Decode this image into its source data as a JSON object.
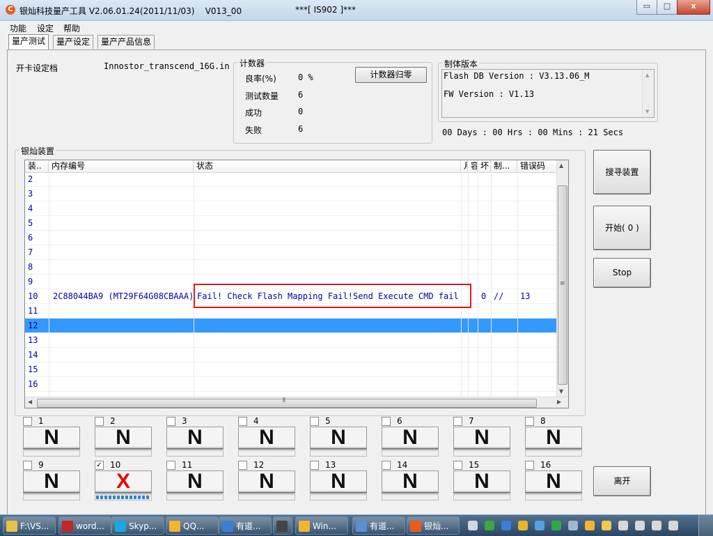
{
  "window": {
    "title_left": "银灿科技量产工具 V2.06.01.24(2011/11/03)    V013_00",
    "title_center": "***[ IS902 ]***",
    "buttons": [
      "▭",
      "□",
      "x"
    ]
  },
  "menu": [
    "功能",
    "设定",
    "帮助"
  ],
  "tabs": [
    "量产测试",
    "量产设定",
    "量产产品信息"
  ],
  "config": {
    "label": "开卡设定档",
    "file": "Innostor_transcend_16G.in"
  },
  "counter": {
    "title": "计数器",
    "rows": [
      {
        "label": "良率(%)",
        "value": "0 %"
      },
      {
        "label": "测试数量",
        "value": "6"
      },
      {
        "label": "成功",
        "value": "0"
      },
      {
        "label": "失败",
        "value": "6"
      }
    ],
    "reset_button": "计数器归零"
  },
  "firmware": {
    "title": "制体版本",
    "line1": "Flash DB Version :  V3.13.06_M",
    "line2": "FW Version :   V1.13"
  },
  "timer": "00 Days : 00 Hrs : 00 Mins : 21 Secs",
  "devices": {
    "title": "银灿装置",
    "columns": [
      "装..",
      "内存编号",
      "状态",
      "月",
      "容",
      "坏",
      "制...",
      "错误码"
    ],
    "rows": [
      {
        "n": "2",
        "mem": "",
        "status": "",
        "c3": "",
        "c4": "",
        "c5": "",
        "c6": "",
        "err": ""
      },
      {
        "n": "3",
        "mem": "",
        "status": "",
        "c3": "",
        "c4": "",
        "c5": "",
        "c6": "",
        "err": ""
      },
      {
        "n": "4",
        "mem": "",
        "status": "",
        "c3": "",
        "c4": "",
        "c5": "",
        "c6": "",
        "err": ""
      },
      {
        "n": "5",
        "mem": "",
        "status": "",
        "c3": "",
        "c4": "",
        "c5": "",
        "c6": "",
        "err": ""
      },
      {
        "n": "6",
        "mem": "",
        "status": "",
        "c3": "",
        "c4": "",
        "c5": "",
        "c6": "",
        "err": ""
      },
      {
        "n": "7",
        "mem": "",
        "status": "",
        "c3": "",
        "c4": "",
        "c5": "",
        "c6": "",
        "err": ""
      },
      {
        "n": "8",
        "mem": "",
        "status": "",
        "c3": "",
        "c4": "",
        "c5": "",
        "c6": "",
        "err": ""
      },
      {
        "n": "9",
        "mem": "",
        "status": "",
        "c3": "",
        "c4": "",
        "c5": "",
        "c6": "",
        "err": ""
      },
      {
        "n": "10",
        "mem": "2C88044BA9 (MT29F64G08CBAAA)",
        "status": "Fail! Check Flash Mapping Fail!Send Execute CMD fail!",
        "c3": "",
        "c4": "",
        "c5": "0",
        "c6": "//",
        "err": "13"
      },
      {
        "n": "11",
        "mem": "",
        "status": "",
        "c3": "",
        "c4": "",
        "c5": "",
        "c6": "",
        "err": ""
      },
      {
        "n": "12",
        "mem": "",
        "status": "",
        "c3": "",
        "c4": "",
        "c5": "",
        "c6": "",
        "err": ""
      },
      {
        "n": "13",
        "mem": "",
        "status": "",
        "c3": "",
        "c4": "",
        "c5": "",
        "c6": "",
        "err": ""
      },
      {
        "n": "14",
        "mem": "",
        "status": "",
        "c3": "",
        "c4": "",
        "c5": "",
        "c6": "",
        "err": ""
      },
      {
        "n": "15",
        "mem": "",
        "status": "",
        "c3": "",
        "c4": "",
        "c5": "",
        "c6": "",
        "err": ""
      },
      {
        "n": "16",
        "mem": "",
        "status": "",
        "c3": "",
        "c4": "",
        "c5": "",
        "c6": "",
        "err": ""
      }
    ],
    "selected_row": "12"
  },
  "slots": [
    {
      "num": "1",
      "checked": false,
      "state": "N",
      "progress": 0
    },
    {
      "num": "2",
      "checked": false,
      "state": "N",
      "progress": 0
    },
    {
      "num": "3",
      "checked": false,
      "state": "N",
      "progress": 0
    },
    {
      "num": "4",
      "checked": false,
      "state": "N",
      "progress": 0
    },
    {
      "num": "5",
      "checked": false,
      "state": "N",
      "progress": 0
    },
    {
      "num": "6",
      "checked": false,
      "state": "N",
      "progress": 0
    },
    {
      "num": "7",
      "checked": false,
      "state": "N",
      "progress": 0
    },
    {
      "num": "8",
      "checked": false,
      "state": "N",
      "progress": 0
    },
    {
      "num": "9",
      "checked": false,
      "state": "N",
      "progress": 0
    },
    {
      "num": "10",
      "checked": true,
      "state": "X",
      "progress": 1.0
    },
    {
      "num": "11",
      "checked": false,
      "state": "N",
      "progress": 0
    },
    {
      "num": "12",
      "checked": false,
      "state": "N",
      "progress": 0
    },
    {
      "num": "13",
      "checked": false,
      "state": "N",
      "progress": 0
    },
    {
      "num": "14",
      "checked": false,
      "state": "N",
      "progress": 0
    },
    {
      "num": "15",
      "checked": false,
      "state": "N",
      "progress": 0
    },
    {
      "num": "16",
      "checked": false,
      "state": "N",
      "progress": 0
    }
  ],
  "actions": {
    "search": "搜寻装置",
    "start": "开始( 0 )",
    "stop": "Stop",
    "exit": "离开"
  },
  "taskbar": [
    {
      "label": "F:\\VS...",
      "icon": "folder-icon",
      "color": "#e8c24a"
    },
    {
      "label": "word...",
      "icon": "filezilla-icon",
      "color": "#c0282a"
    },
    {
      "label": "Skyp...",
      "icon": "skype-icon",
      "color": "#17a8e3"
    },
    {
      "label": "QQ...",
      "icon": "qq-icon",
      "color": "#f2b530"
    },
    {
      "label": "有道...",
      "icon": "youdao-icon",
      "color": "#3a7fd6"
    },
    {
      "label": "",
      "icon": "clapper-icon",
      "color": "#444444"
    },
    {
      "label": "Win...",
      "icon": "window-icon",
      "color": "#f2b530"
    },
    {
      "label": "有道...",
      "icon": "dict-icon",
      "color": "#5a8ed6"
    },
    {
      "label": "银灿...",
      "icon": "app-icon",
      "color": "#e85c1d"
    }
  ],
  "tray_icons": [
    "keyboard-icon",
    "evernote-icon",
    "pen-icon",
    "shield-icon",
    "chat-icon",
    "check-icon",
    "network-icon",
    "qq-tray-icon",
    "smile-icon",
    "usb-icon",
    "battery-icon",
    "signal-icon",
    "volume-icon"
  ]
}
